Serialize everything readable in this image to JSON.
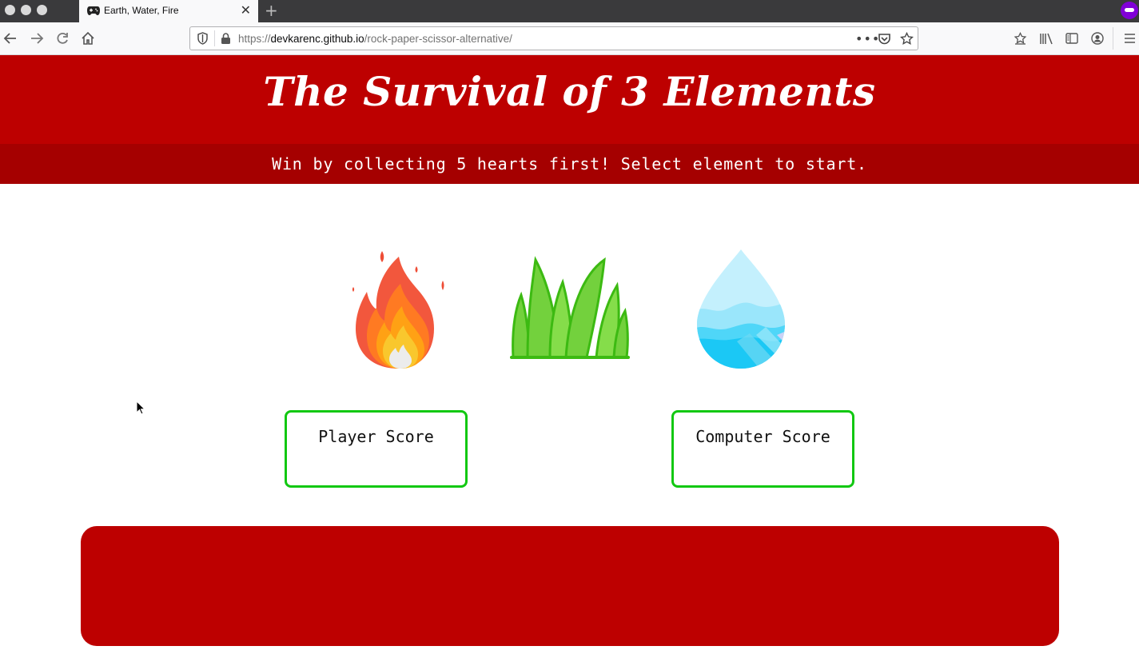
{
  "browser": {
    "tab_title": "Earth, Water, Fire",
    "url_prefix": "https://",
    "url_domain": "devkarenc.github.io",
    "url_path": "/rock-paper-scissor-alternative/",
    "new_tab_symbol": "+",
    "close_symbol": "✕"
  },
  "header": {
    "title": "The Survival of 3 Elements",
    "subtitle": "Win by collecting 5 hearts first! Select element to start."
  },
  "elements": [
    {
      "name": "fire",
      "icon": "fire-icon"
    },
    {
      "name": "earth",
      "icon": "grass-icon"
    },
    {
      "name": "water",
      "icon": "water-drop-icon"
    }
  ],
  "scores": {
    "player_label": "Player Score",
    "player_value": "",
    "computer_label": "Computer Score",
    "computer_value": ""
  },
  "result": {
    "message": ""
  },
  "colors": {
    "header_red": "#bd0000",
    "subbar_red": "#a50000",
    "score_border_green": "#12c812"
  }
}
